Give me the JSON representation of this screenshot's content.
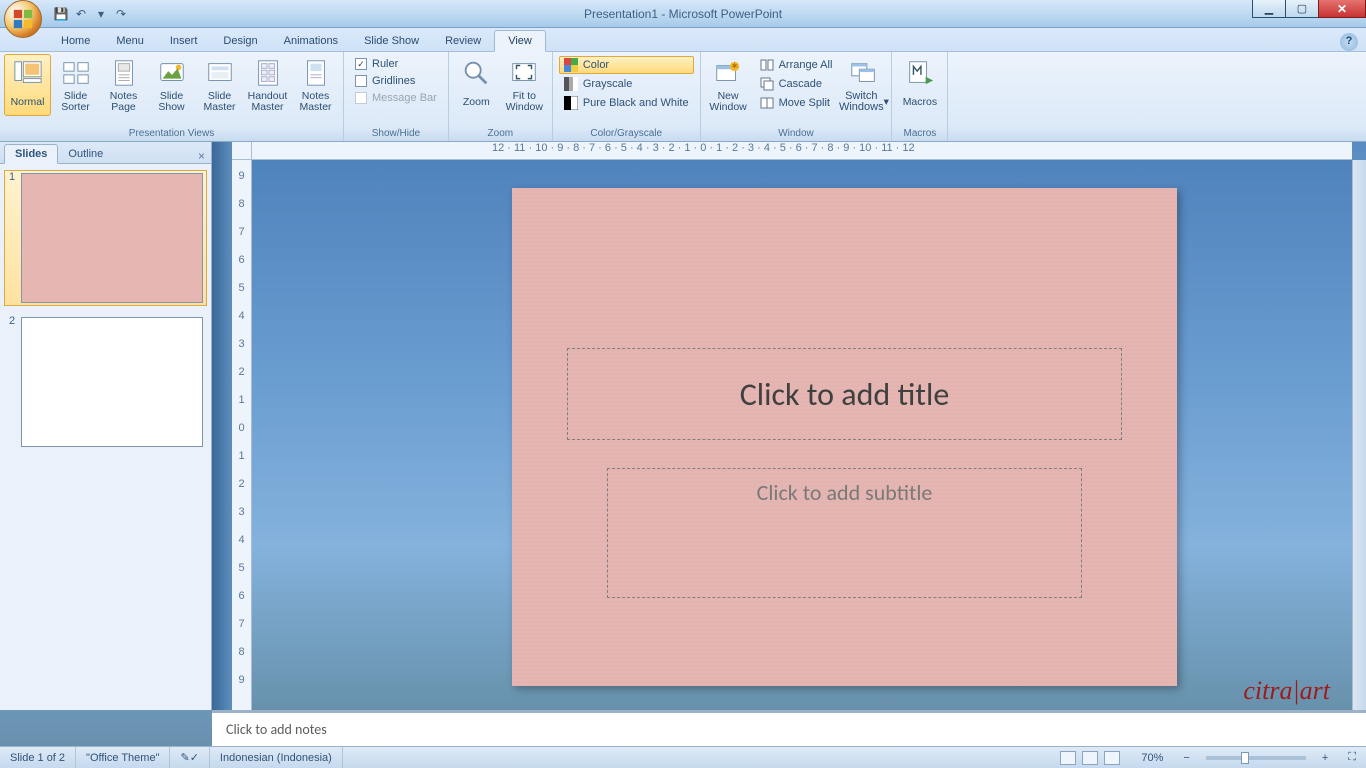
{
  "title": "Presentation1 - Microsoft PowerPoint",
  "tabs": [
    "Home",
    "Menu",
    "Insert",
    "Design",
    "Animations",
    "Slide Show",
    "Review",
    "View"
  ],
  "active_tab": "View",
  "ribbon": {
    "presentation_views": {
      "label": "Presentation Views",
      "items": [
        "Normal",
        "Slide Sorter",
        "Notes Page",
        "Slide Show",
        "Slide Master",
        "Handout Master",
        "Notes Master"
      ]
    },
    "show_hide": {
      "label": "Show/Hide",
      "ruler": "Ruler",
      "ruler_checked": true,
      "gridlines": "Gridlines",
      "gridlines_checked": false,
      "message_bar": "Message Bar"
    },
    "zoom": {
      "label": "Zoom",
      "zoom": "Zoom",
      "fit": "Fit to Window"
    },
    "color_grayscale": {
      "label": "Color/Grayscale",
      "color": "Color",
      "grayscale": "Grayscale",
      "pbw": "Pure Black and White"
    },
    "window": {
      "label": "Window",
      "new_window": "New Window",
      "arrange_all": "Arrange All",
      "cascade": "Cascade",
      "move_split": "Move Split",
      "switch": "Switch Windows"
    },
    "macros": {
      "label": "Macros",
      "macros": "Macros"
    }
  },
  "left_panel": {
    "tabs": [
      "Slides",
      "Outline"
    ],
    "active": "Slides",
    "slides": [
      {
        "num": "1",
        "pink": true,
        "selected": true
      },
      {
        "num": "2",
        "pink": false,
        "selected": false
      }
    ]
  },
  "slide": {
    "title_placeholder": "Click to add title",
    "subtitle_placeholder": "Click to add subtitle"
  },
  "notes_placeholder": "Click to add notes",
  "hruler_text": "12 · 11 · 10 · 9 · 8 · 7 · 6 · 5 · 4 · 3 · 2 · 1 · 0 · 1 · 2 · 3 · 4 · 5 · 6 · 7 · 8 · 9 · 10 · 11 · 12",
  "vruler_vals": [
    "9",
    "8",
    "7",
    "6",
    "5",
    "4",
    "3",
    "2",
    "1",
    "0",
    "1",
    "2",
    "3",
    "4",
    "5",
    "6",
    "7",
    "8",
    "9"
  ],
  "status": {
    "slide": "Slide 1 of 2",
    "theme": "\"Office Theme\"",
    "lang": "Indonesian (Indonesia)",
    "zoom": "70%"
  },
  "watermark": "citra|art"
}
